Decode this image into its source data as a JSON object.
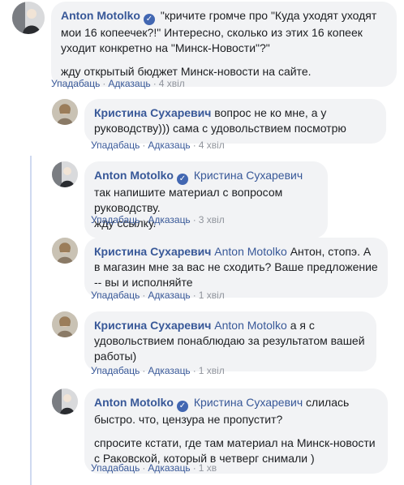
{
  "comments": [
    {
      "author": "Anton Motolko",
      "paragraphs": [
        "\"кричите громче про \"Куда уходят уходят мои 16 копеечек?!\" Интересно, сколько из этих 16 копеек уходит конкретно на \"Минск-Новости\"?\"",
        "жду открытый бюджет Минск-новости на сайте."
      ],
      "like": "Упадабаць",
      "reply": "Адказаць",
      "time": "4 хвіл"
    },
    {
      "author": "Кристина Сухаревич",
      "paragraphs": [
        "вопрос не ко мне, а у руководству))) сама с удовольствием посмотрю"
      ],
      "like": "Упадабаць",
      "reply": "Адказаць",
      "time": "4 хвіл"
    },
    {
      "author": "Anton Motolko",
      "mention": "Кристина Сухаревич",
      "paragraphs": [
        "так напишите материал с вопросом руководству.",
        "жду ссылку."
      ],
      "like": "Упадабаць",
      "reply": "Адказаць",
      "time": "3 хвіл"
    },
    {
      "author": "Кристина Сухаревич",
      "mention": "Anton Motolko",
      "paragraphs": [
        "Антон, стопэ. А в магазин мне за вас не сходить? Ваше предложение -- вы и исполняйте"
      ],
      "like": "Упадабаць",
      "reply": "Адказаць",
      "time": "1 хвіл"
    },
    {
      "author": "Кристина Сухаревич",
      "mention": "Anton Motolko",
      "paragraphs": [
        "а я с удовольствием понаблюдаю за результатом вашей работы)"
      ],
      "like": "Упадабаць",
      "reply": "Адказаць",
      "time": "1 хвіл"
    },
    {
      "author": "Anton Motolko",
      "mention": "Кристина Сухаревич",
      "paragraphs": [
        "слилась быстро. что, цензура не пропустит?",
        "спросите кстати, где там материал на Минск-новости с Раковской, который в четверг снимали )"
      ],
      "like": "Упадабаць",
      "reply": "Адказаць",
      "time": "1 хв"
    }
  ],
  "colors": {
    "link": "#385898",
    "bubble": "#f2f3f5",
    "meta": "#90949c",
    "thread": "#cfd9f0"
  },
  "icons": {
    "verified": "verified-check-icon"
  }
}
